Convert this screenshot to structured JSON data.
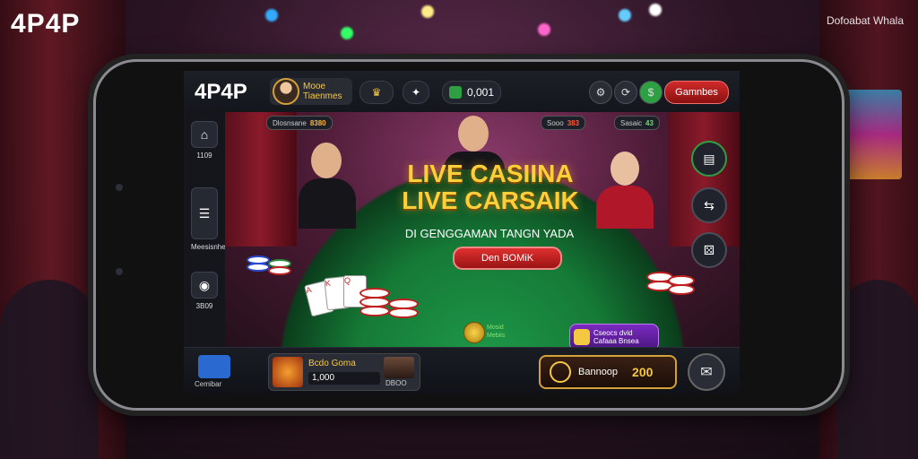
{
  "brand": "4P4P",
  "tagline": "Dofoabat Whala",
  "app": {
    "logo": "4P4P",
    "profile": {
      "name_line1": "Mooe",
      "name_line2": "Tiaenmes"
    },
    "crown_icon": "crown-icon",
    "star_icon": "star-icon",
    "balance_pill": "0,001",
    "games_button": "Gamnbes",
    "top_icons": [
      "settings-icon",
      "refresh-icon",
      "cash-icon"
    ]
  },
  "sidebar": {
    "items": [
      {
        "label": "1109",
        "icon": "home-icon"
      },
      {
        "label": "Meesisnhe",
        "icon": "menu-icon"
      },
      {
        "label": "3B09",
        "icon": "chip-icon"
      }
    ]
  },
  "hero": {
    "tag_left": {
      "label": "Dlosnsane",
      "value": "8380"
    },
    "tag_mid": {
      "label": "Sooo",
      "value": "383"
    },
    "tag_right": {
      "label": "Sasaic",
      "value": "43"
    },
    "headline_1": "LIVE CASIINA",
    "headline_2": "LIVE CARSAIK",
    "subline": "DI GENGGAMAN TANGN YADA",
    "play_button": "Den BOMiK",
    "vip": {
      "line1": "Mosid",
      "line2": "Mebiis"
    },
    "promo": {
      "line1": "Cseocs dvid",
      "line2": "Cafaaa Bnsea"
    }
  },
  "right_controls": [
    "ledger-icon",
    "arrows-icon",
    "dice-icon"
  ],
  "bottom": {
    "home_label": "Cemibar",
    "game_card": {
      "title": "Bcdo Goma",
      "value": "1,000",
      "label2": "DBOO"
    },
    "balance": {
      "label": "Bannoop",
      "value": "200"
    },
    "chat_icon": "chat-icon"
  }
}
